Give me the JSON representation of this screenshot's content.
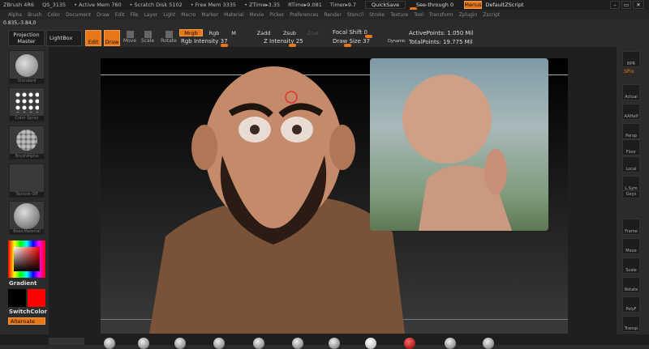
{
  "title_bar": {
    "app": "ZBrush 4R6",
    "doc": "QS_3135",
    "active_mem": "• Active Mem 760",
    "scratch": "• Scratch Disk 5102",
    "free_mem": "• Free Mem 3335",
    "ztime": "• ZTime▸3.35",
    "rtime": "RTime▸9.081",
    "timer": "Timer▸9.7",
    "quicksave": "QuickSave",
    "see_through": "See-through  0",
    "see_through_value": 0,
    "menus": "Menus",
    "script": "DefaultZScript"
  },
  "menu": [
    "Alpha",
    "Brush",
    "Color",
    "Document",
    "Draw",
    "Edit",
    "File",
    "Layer",
    "Light",
    "Macro",
    "Marker",
    "Material",
    "Movie",
    "Picker",
    "Preferences",
    "Render",
    "Stencil",
    "Stroke",
    "Texture",
    "Tool",
    "Transform",
    "Zplugin",
    "Zscript"
  ],
  "coords": "0.835,-3.84,0",
  "shelf": {
    "projection_master": "Projection Master",
    "lightbox": "LightBox",
    "edit": "Edit",
    "draw": "Draw",
    "move": "Move",
    "scale": "Scale",
    "rotate": "Rotate",
    "mrgb": "Mrgb",
    "rgb": "Rgb",
    "m": "M",
    "zadd": "Zadd",
    "zsub": "Zsub",
    "zcut": "Zcut",
    "rgb_intensity": "Rgb Intensity 37",
    "z_intensity": "Z Intensity 25",
    "focal_shift": "Focal Shift 0",
    "draw_size": "Draw Size 37",
    "dynamic": "Dynamic",
    "active_points": "ActivePoints: 1.050 Mil",
    "total_points": "TotalPoints: 19.775 Mil"
  },
  "left": {
    "brush": "Standard",
    "stroke": "Color Spray",
    "alpha": "BrushAlpha",
    "texture": "Texture Off",
    "material": "BasicMaterial",
    "gradient": "Gradient",
    "switch_color": "SwitchColor",
    "alternate": "Alternate",
    "main_color": "#000000",
    "secondary_color": "#ff0000"
  },
  "right": {
    "bpr": "BPR",
    "spix": "SPix",
    "items": [
      "Actual",
      "AAHalf",
      "Persp",
      "Floor",
      "Local",
      "L.Sym",
      "Gxyz",
      "Frame",
      "Move",
      "Scale",
      "Rotate",
      "PolyF",
      "Transp"
    ]
  },
  "accent": "#e8771a"
}
